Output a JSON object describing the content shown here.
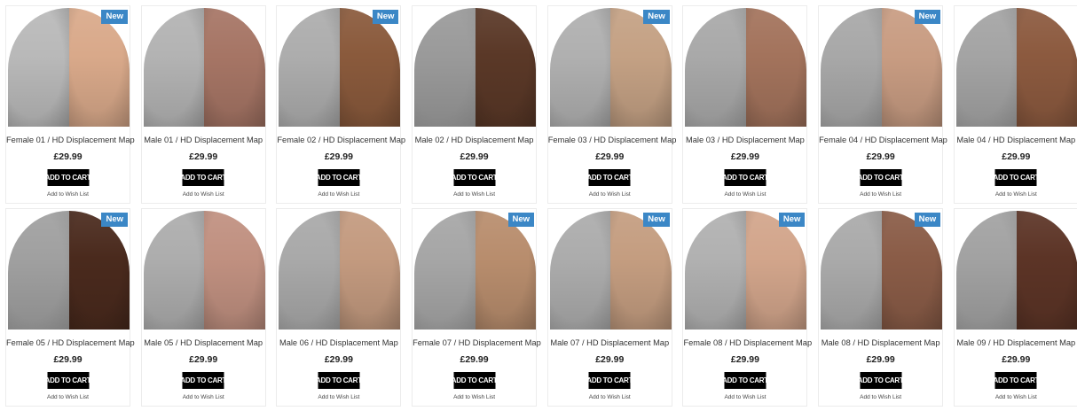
{
  "products": [
    {
      "title": "Female 01 / HD Displacement Map",
      "price": "£29.99",
      "cart_label": "ADD TO CART",
      "wish_label": "Add to Wish List",
      "badge": "New",
      "skin_color": "#d9a98a",
      "map_color": "#b9b9b9"
    },
    {
      "title": "Male 01 / HD Displacement Map",
      "price": "£29.99",
      "cart_label": "ADD TO CART",
      "wish_label": "Add to Wish List",
      "badge": "",
      "skin_color": "#a67565",
      "map_color": "#b3b3b3"
    },
    {
      "title": "Female 02 / HD Displacement Map",
      "price": "£29.99",
      "cart_label": "ADD TO CART",
      "wish_label": "Add to Wish List",
      "badge": "New",
      "skin_color": "#8a5a3c",
      "map_color": "#adadad"
    },
    {
      "title": "Male 02 / HD Displacement Map",
      "price": "£29.99",
      "cart_label": "ADD TO CART",
      "wish_label": "Add to Wish List",
      "badge": "",
      "skin_color": "#5a3827",
      "map_color": "#9a9a9a"
    },
    {
      "title": "Female 03 / HD Displacement Map",
      "price": "£29.99",
      "cart_label": "ADD TO CART",
      "wish_label": "Add to Wish List",
      "badge": "New",
      "skin_color": "#c4a184",
      "map_color": "#b0b0b0"
    },
    {
      "title": "Male 03 / HD Displacement Map",
      "price": "£29.99",
      "cart_label": "ADD TO CART",
      "wish_label": "Add to Wish List",
      "badge": "",
      "skin_color": "#a3735c",
      "map_color": "#a9a9a9"
    },
    {
      "title": "Female 04 / HD Displacement Map",
      "price": "£29.99",
      "cart_label": "ADD TO CART",
      "wish_label": "Add to Wish List",
      "badge": "New",
      "skin_color": "#c89c82",
      "map_color": "#a8a8a8"
    },
    {
      "title": "Male 04 / HD Displacement Map",
      "price": "£29.99",
      "cart_label": "ADD TO CART",
      "wish_label": "Add to Wish List",
      "badge": "",
      "skin_color": "#8c5a3f",
      "map_color": "#a4a4a4"
    },
    {
      "title": "Female 05 / HD Displacement Map",
      "price": "£29.99",
      "cart_label": "ADD TO CART",
      "wish_label": "Add to Wish List",
      "badge": "New",
      "skin_color": "#4a2a1d",
      "map_color": "#a0a0a0"
    },
    {
      "title": "Male 05 / HD Displacement Map",
      "price": "£29.99",
      "cart_label": "ADD TO CART",
      "wish_label": "Add to Wish List",
      "badge": "",
      "skin_color": "#c09080",
      "map_color": "#adadad"
    },
    {
      "title": "Male 06 / HD Displacement Map",
      "price": "£29.99",
      "cart_label": "ADD TO CART",
      "wish_label": "Add to Wish List",
      "badge": "",
      "skin_color": "#c39a7f",
      "map_color": "#a9a9a9"
    },
    {
      "title": "Female 07 / HD Displacement Map",
      "price": "£29.99",
      "cart_label": "ADD TO CART",
      "wish_label": "Add to Wish List",
      "badge": "New",
      "skin_color": "#b88d6d",
      "map_color": "#a6a6a6"
    },
    {
      "title": "Male 07 / HD Displacement Map",
      "price": "£29.99",
      "cart_label": "ADD TO CART",
      "wish_label": "Add to Wish List",
      "badge": "New",
      "skin_color": "#c49d80",
      "map_color": "#acacac"
    },
    {
      "title": "Female 08 / HD Displacement Map",
      "price": "£29.99",
      "cart_label": "ADD TO CART",
      "wish_label": "Add to Wish List",
      "badge": "New",
      "skin_color": "#d2a58b",
      "map_color": "#b1b1b1"
    },
    {
      "title": "Male 08 / HD Displacement Map",
      "price": "£29.99",
      "cart_label": "ADD TO CART",
      "wish_label": "Add to Wish List",
      "badge": "New",
      "skin_color": "#8a5c47",
      "map_color": "#aaaaaa"
    },
    {
      "title": "Male 09 / HD Displacement Map",
      "price": "£29.99",
      "cart_label": "ADD TO CART",
      "wish_label": "Add to Wish List",
      "badge": "",
      "skin_color": "#5c3426",
      "map_color": "#a2a2a2"
    }
  ]
}
